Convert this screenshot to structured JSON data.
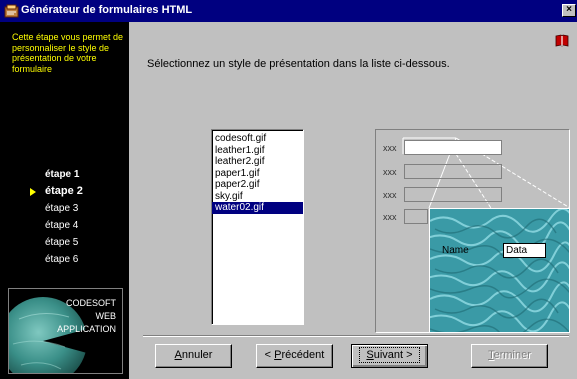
{
  "window": {
    "title": "Générateur de formulaires HTML",
    "close_glyph": "×"
  },
  "sidebar": {
    "description": "Cette étape vous permet de personnaliser le style de présentation de votre formulaire",
    "steps": [
      "étape 1",
      "étape 2",
      "étape 3",
      "étape 4",
      "étape 5",
      "étape 6"
    ],
    "current_step": "étape 2",
    "logo": {
      "lines": [
        "CODESOFT",
        "WEB",
        "APPLICATION"
      ]
    }
  },
  "main": {
    "instruction": "Sélectionnez un style de présentation dans la liste ci-dessous.",
    "styles": [
      "codesoft.gif",
      "leather1.gif",
      "leather2.gif",
      "paper1.gif",
      "paper2.gif",
      "sky.gif",
      "water02.gif"
    ],
    "selected_style": "water02.gif",
    "preview": {
      "field_labels": [
        "xxx",
        "xxx",
        "xxx",
        "xxx"
      ],
      "zoom_label": "Name",
      "zoom_value": "Data"
    }
  },
  "buttons": {
    "cancel": {
      "mnemonic": "A",
      "rest": "nnuler"
    },
    "previous": {
      "prefix": "< ",
      "mnemonic": "P",
      "rest": "récédent"
    },
    "next": {
      "mnemonic": "S",
      "rest": "uivant >"
    },
    "finish": {
      "mnemonic": "T",
      "rest": "erminer"
    }
  },
  "colors": {
    "title_bar": "#000080",
    "sidebar_bg": "#000000",
    "sidebar_text": "#ffff00",
    "selection": "#000080",
    "water_teal": "#3a9aa6"
  },
  "icons": {
    "app": "form-generator-icon",
    "help": "book-help-icon",
    "close": "close-icon",
    "step_pointer": "triangle-right-icon"
  }
}
